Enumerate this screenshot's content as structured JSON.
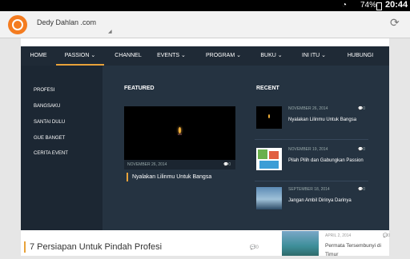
{
  "status_bar": {
    "battery": "74%",
    "time": "20:44"
  },
  "browser": {
    "tab_title": "Dedy Dahlan .com"
  },
  "nav": {
    "items": [
      {
        "label": "HOME"
      },
      {
        "label": "PASSION ⌄",
        "active": true
      },
      {
        "label": "CHANNEL"
      },
      {
        "label": "EVENTS ⌄"
      },
      {
        "label": "PROGRAM ⌄"
      },
      {
        "label": "BUKU ⌄"
      },
      {
        "label": "INI ITU ⌄"
      },
      {
        "label": "HUBUNGI"
      }
    ]
  },
  "mega_menu": {
    "categories": [
      "PROFESI",
      "BANGSAKU",
      "SANTAI DULU",
      "GUE BANGET",
      "CERITA EVENT"
    ],
    "featured": {
      "heading": "FEATURED",
      "date": "NOVEMBER 26, 2014",
      "comments": "0",
      "title": "Nyalakan Lilinmu Untuk Bangsa"
    },
    "recent": {
      "heading": "RECENT",
      "items": [
        {
          "date": "NOVEMBER 26, 2014",
          "comments": "0",
          "title": "Nyalakan Lilinmu Untuk Bangsa"
        },
        {
          "date": "NOVEMBER 19, 2014",
          "comments": "0",
          "title": "Pilah Pilih dan Gabungkan Passion"
        },
        {
          "date": "SEPTEMBER 18, 2014",
          "comments": "0",
          "title": "Jangan Ambil Dirinya Darinya"
        }
      ]
    }
  },
  "article": {
    "title": "7 Persiapan Untuk Pindah Profesi",
    "comments": "0"
  },
  "sidebar": {
    "date": "APRIL 2, 2014",
    "comments": "0",
    "title": "Permata Tersembunyi di Timur"
  },
  "colors": {
    "accent": "#e8a23a",
    "nav_bg": "#1f2a36",
    "menu_bg": "#253341",
    "logo": "#f47c20"
  }
}
